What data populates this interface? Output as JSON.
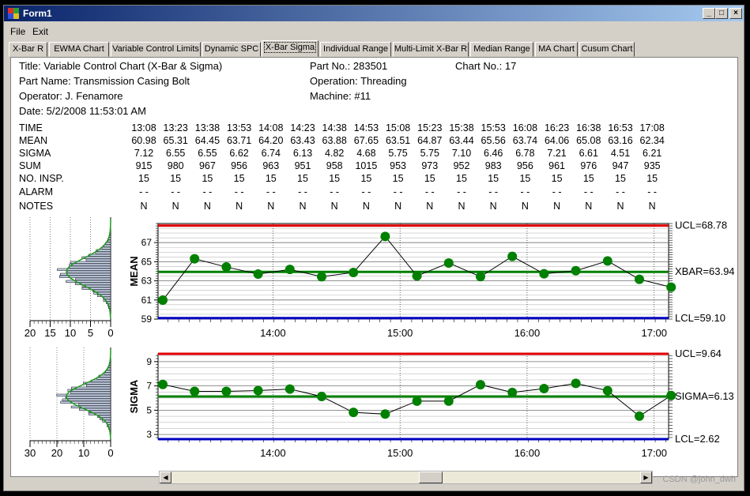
{
  "window": {
    "title": "Form1",
    "min_glyph": "_",
    "max_glyph": "□",
    "close_glyph": "×"
  },
  "menu": [
    "File",
    "Exit"
  ],
  "tabs": [
    "X-Bar R",
    "EWMA Chart",
    "Variable Control Limits",
    "Dynamic SPC",
    "X-Bar Sigma",
    "Individual Range",
    "Multi-Limit X-Bar R",
    "Median Range",
    "MA Chart",
    "Cusum Chart"
  ],
  "active_tab": "X-Bar Sigma",
  "header": {
    "title": "Title: Variable Control Chart (X-Bar & Sigma)",
    "part_no": "Part No.: 283501",
    "chart_no": "Chart No.: 17",
    "part_name": "Part Name: Transmission Casing Bolt",
    "operation": "Operation: Threading",
    "operator": "Operator: J. Fenamore",
    "machine": "Machine: #11",
    "date": "Date: 5/2/2008 11:53:01 AM"
  },
  "table": {
    "row_labels": [
      "TIME",
      "MEAN",
      "SIGMA",
      "SUM",
      "NO. INSP.",
      "ALARM",
      "NOTES"
    ],
    "time": [
      "13:08",
      "13:23",
      "13:38",
      "13:53",
      "14:08",
      "14:23",
      "14:38",
      "14:53",
      "15:08",
      "15:23",
      "15:38",
      "15:53",
      "16:08",
      "16:23",
      "16:38",
      "16:53",
      "17:08"
    ],
    "mean": [
      "60.98",
      "65.31",
      "64.45",
      "63.71",
      "64.20",
      "63.43",
      "63.88",
      "67.65",
      "63.51",
      "64.87",
      "63.44",
      "65.56",
      "63.74",
      "64.06",
      "65.08",
      "63.16",
      "62.34"
    ],
    "sigma": [
      "7.12",
      "6.55",
      "6.55",
      "6.62",
      "6.74",
      "6.13",
      "4.82",
      "4.68",
      "5.75",
      "5.75",
      "7.10",
      "6.46",
      "6.78",
      "7.21",
      "6.61",
      "4.51",
      "6.21"
    ],
    "sum": [
      "915",
      "980",
      "967",
      "956",
      "963",
      "951",
      "958",
      "1015",
      "953",
      "973",
      "952",
      "983",
      "956",
      "961",
      "976",
      "947",
      "935"
    ],
    "no_insp": [
      "15",
      "15",
      "15",
      "15",
      "15",
      "15",
      "15",
      "15",
      "15",
      "15",
      "15",
      "15",
      "15",
      "15",
      "15",
      "15",
      "15"
    ],
    "alarm": [
      "- -",
      "- -",
      "- -",
      "- -",
      "- -",
      "- -",
      "- -",
      "- -",
      "- -",
      "- -",
      "- -",
      "- -",
      "- -",
      "- -",
      "- -",
      "- -",
      "- -"
    ],
    "notes": [
      "N",
      "N",
      "N",
      "N",
      "N",
      "N",
      "N",
      "N",
      "N",
      "N",
      "N",
      "N",
      "N",
      "N",
      "N",
      "N",
      "N"
    ]
  },
  "chart_data": [
    {
      "type": "line",
      "ylabel": "MEAN",
      "x": [
        "13:08",
        "13:23",
        "13:38",
        "13:53",
        "14:08",
        "14:23",
        "14:38",
        "14:53",
        "15:08",
        "15:23",
        "15:38",
        "15:53",
        "16:08",
        "16:23",
        "16:38",
        "16:53",
        "17:08"
      ],
      "values": [
        60.98,
        65.31,
        64.45,
        63.71,
        64.2,
        63.43,
        63.88,
        67.65,
        63.51,
        64.87,
        63.44,
        65.56,
        63.74,
        64.06,
        65.08,
        63.16,
        62.34
      ],
      "ylim": [
        59,
        69
      ],
      "yticks": [
        59,
        61,
        63,
        65,
        67
      ],
      "xtick_labels": [
        "14:00",
        "15:00",
        "16:00",
        "17:00"
      ],
      "limits": {
        "ucl": 68.78,
        "center": 63.94,
        "lcl": 59.1
      },
      "limit_labels": {
        "ucl": "UCL=68.78",
        "center": "XBAR=63.94",
        "lcl": "LCL=59.10"
      },
      "colors": {
        "ucl": "#e00000",
        "center": "#008000",
        "lcl": "#0000c0",
        "points": "#008000",
        "line": "#000000"
      },
      "histogram": {
        "xlim": [
          20,
          0
        ],
        "ticks": [
          "20",
          "15",
          "10",
          "5",
          "0"
        ]
      }
    },
    {
      "type": "line",
      "ylabel": "SIGMA",
      "x": [
        "13:08",
        "13:23",
        "13:38",
        "13:53",
        "14:08",
        "14:23",
        "14:38",
        "14:53",
        "15:08",
        "15:23",
        "15:38",
        "15:53",
        "16:08",
        "16:23",
        "16:38",
        "16:53",
        "17:08"
      ],
      "values": [
        7.12,
        6.55,
        6.55,
        6.62,
        6.74,
        6.13,
        4.82,
        4.68,
        5.75,
        5.75,
        7.1,
        6.46,
        6.78,
        7.21,
        6.61,
        4.51,
        6.21
      ],
      "ylim": [
        2.62,
        9.64
      ],
      "yticks": [
        3,
        5,
        7,
        9
      ],
      "xtick_labels": [
        "14:00",
        "15:00",
        "16:00",
        "17:00"
      ],
      "limits": {
        "ucl": 9.64,
        "center": 6.13,
        "lcl": 2.62
      },
      "limit_labels": {
        "ucl": "UCL=9.64",
        "center": "SIGMA=6.13",
        "lcl": "LCL=2.62"
      },
      "colors": {
        "ucl": "#e00000",
        "center": "#008000",
        "lcl": "#0000c0",
        "points": "#008000",
        "line": "#000000"
      },
      "histogram": {
        "xlim": [
          30,
          0
        ],
        "ticks": [
          "30",
          "20",
          "10",
          "0"
        ]
      }
    }
  ],
  "watermark": "CSDN @john_dwh"
}
